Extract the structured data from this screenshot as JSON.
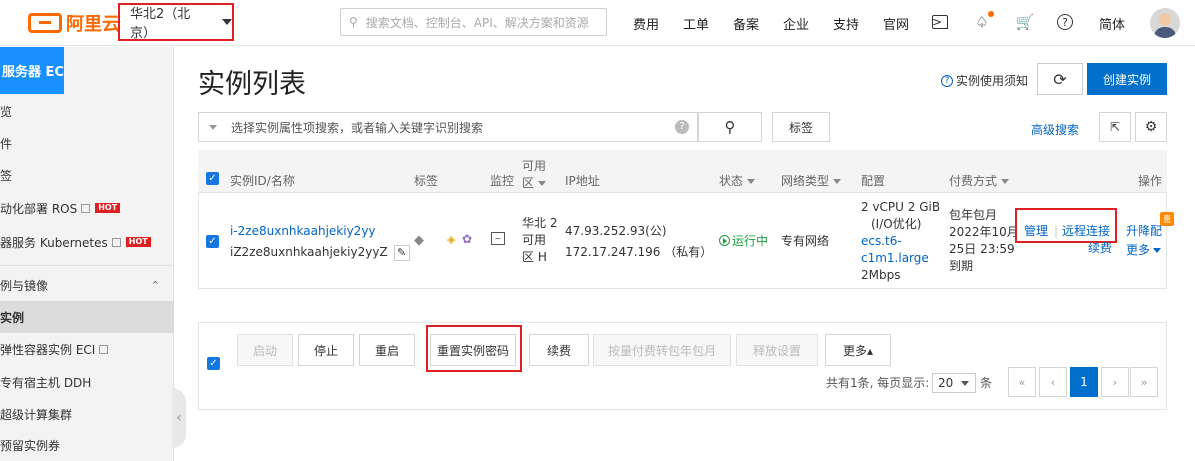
{
  "colors": {
    "brand": "#ff6a00",
    "primary": "#0070cc",
    "link": "#0064c8",
    "highlight_box": "#e02020",
    "running": "#1a9e3f"
  },
  "topbar": {
    "logo_text": "阿里云",
    "region": "华北2（北京）",
    "search_placeholder": "搜索文档、控制台、API、解决方案和资源",
    "nav": [
      "费用",
      "工单",
      "备案",
      "企业",
      "支持",
      "官网"
    ],
    "lang": "简体",
    "icons": [
      "terminal-icon",
      "bell-icon",
      "cart-icon",
      "help-icon"
    ]
  },
  "sidebar": {
    "header": "服务器 ECS",
    "items": [
      {
        "label": "览"
      },
      {
        "label": "件"
      },
      {
        "label": "签"
      },
      {
        "label": "动化部署 ROS",
        "badge": "HOT"
      },
      {
        "label": "器服务 Kubernetes",
        "badge": "HOT"
      },
      {
        "label": "例与镜像"
      },
      {
        "label": "实例"
      },
      {
        "label": "弹性容器实例 ECI"
      },
      {
        "label": "专有宿主机 DDH"
      },
      {
        "label": "超级计算集群"
      },
      {
        "label": "预留实例券"
      }
    ]
  },
  "main": {
    "title": "实例列表",
    "notice": "实例使用须知",
    "create_btn": "创建实例",
    "filter_placeholder": "选择实例属性项搜索，或者输入关键字识别搜索",
    "tag_btn": "标签",
    "adv_search": "高级搜索"
  },
  "table": {
    "headers": {
      "id": "实例ID/名称",
      "tag": "标签",
      "monitor": "监控",
      "zone_l1": "可用",
      "zone_l2": "区",
      "ip": "IP地址",
      "status": "状态",
      "net": "网络类型",
      "config": "配置",
      "billing": "付费方式",
      "ops": "操作"
    },
    "row": {
      "id": "i-2ze8uxnhkaahjekiy2yy",
      "name": "iZ2ze8uxnhkaahjekiy2yyZ",
      "zone": [
        "华北 2",
        "可用",
        "区 H"
      ],
      "public_ip": "47.93.252.93(公)",
      "private_ip": "172.17.247.196 （私有）",
      "status": "运行中",
      "net_type": "专有网络",
      "config": [
        "2 vCPU 2 GiB",
        "(I/O优化)"
      ],
      "instance_type": [
        "ecs.t6-",
        "c1m1.large"
      ],
      "bandwidth": "2Mbps",
      "billing": [
        "包年包月",
        "2022年10月",
        "25日 23:59",
        "到期"
      ],
      "ops": {
        "manage": "管理",
        "remote": "远程连接",
        "upgrade": "升降配",
        "renew": "续费",
        "more": "更多"
      },
      "promo_badge": "惠"
    }
  },
  "bottom": {
    "buttons": [
      {
        "label": "启动",
        "disabled": true
      },
      {
        "label": "停止",
        "disabled": false
      },
      {
        "label": "重启",
        "disabled": false
      },
      {
        "label": "重置实例密码",
        "disabled": false
      },
      {
        "label": "续费",
        "disabled": false
      },
      {
        "label": "按量付费转包年包月",
        "disabled": true
      },
      {
        "label": "释放设置",
        "disabled": true
      },
      {
        "label": "更多▴",
        "disabled": false
      }
    ],
    "pagination": {
      "summary": "共有1条, 每页显示:",
      "page_size": "20",
      "unit": "条",
      "current": "1",
      "first": "«",
      "prev": "‹",
      "next": "›",
      "last": "»"
    }
  }
}
